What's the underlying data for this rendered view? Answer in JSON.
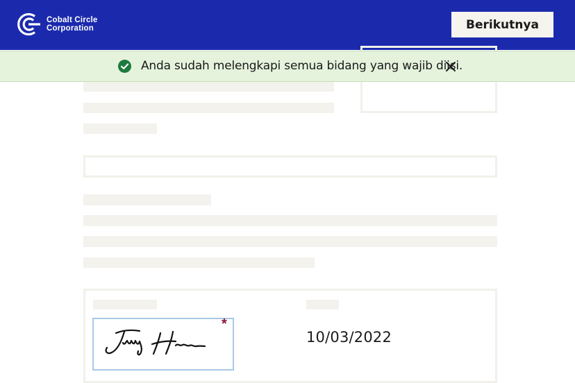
{
  "header": {
    "company_line1": "Cobalt Circle",
    "company_line2": "Corporation",
    "next_label": "Berikutnya",
    "logo_icon": "circle-logo-icon",
    "background_color": "#1b2aad"
  },
  "toast": {
    "message": "Anda sudah melengkapi semua bidang yang wajib diisi.",
    "status_icon": "check-circle-icon",
    "close_icon": "close-icon",
    "background_color": "#e5f3dd",
    "icon_color": "#1d7a3e"
  },
  "signature_section": {
    "required_marker": "*",
    "date_value": "10/03/2022",
    "signature_icon": "handwritten-signature",
    "required_color": "#8a1538"
  }
}
